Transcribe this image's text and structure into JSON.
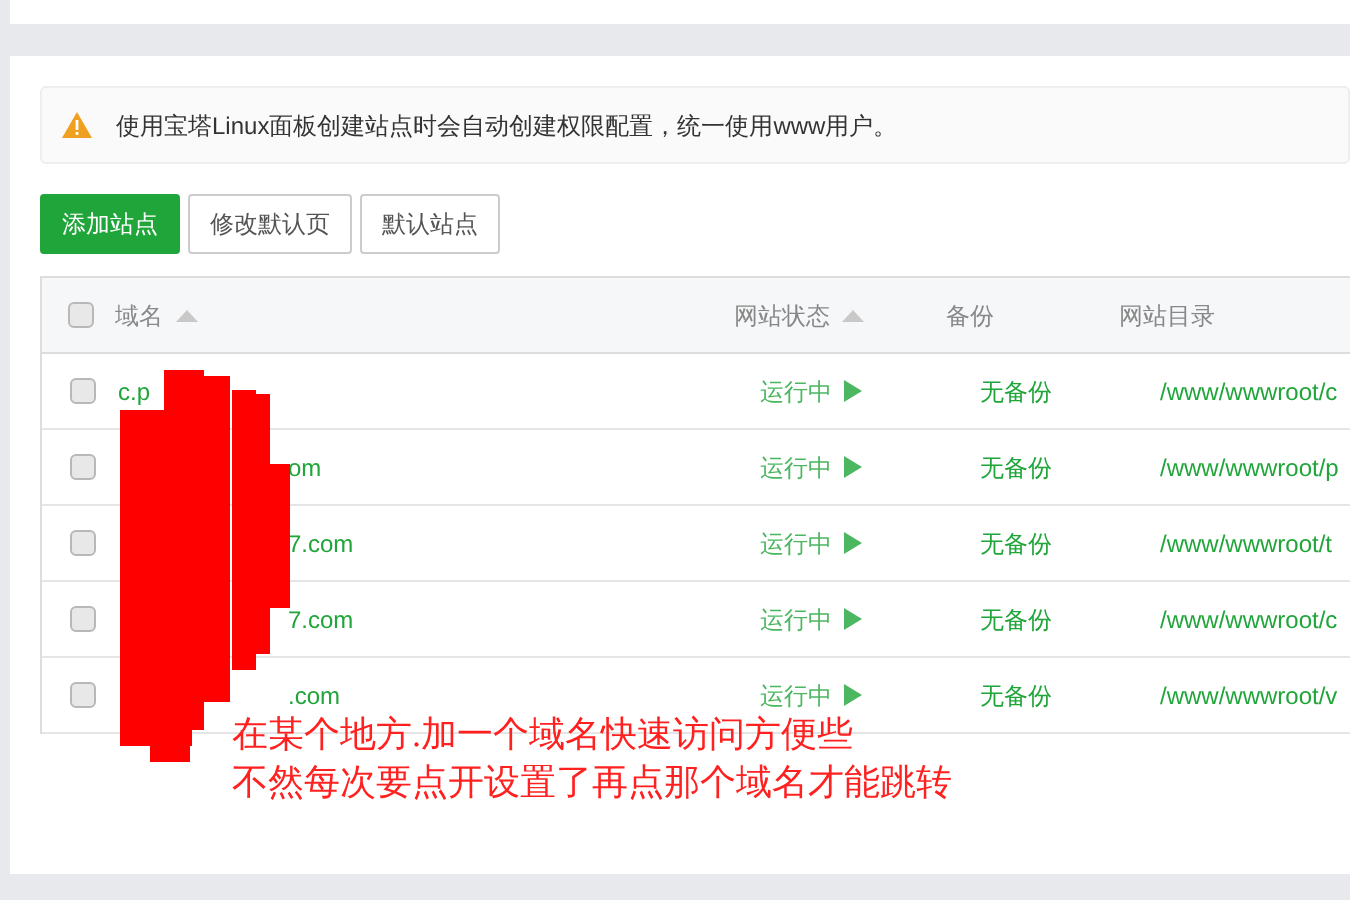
{
  "alert": {
    "text": "使用宝塔Linux面板创建站点时会自动创建权限配置，统一使用www用户。"
  },
  "buttons": [
    {
      "label": "添加站点",
      "kind": "primary"
    },
    {
      "label": "修改默认页",
      "kind": "default"
    },
    {
      "label": "默认站点",
      "kind": "default"
    }
  ],
  "table": {
    "select_all": {
      "checked": false
    },
    "columns": [
      {
        "label": "域名",
        "sortable": true
      },
      {
        "label": "网站状态",
        "sortable": true
      },
      {
        "label": "备份",
        "sortable": false
      },
      {
        "label": "网站目录",
        "sortable": false
      }
    ],
    "rows": [
      {
        "checked": false,
        "domain": "c.p",
        "redacted_prefix": false,
        "status": "运行中",
        "running": true,
        "backup": "无备份",
        "directory": "/www/wwwroot/c"
      },
      {
        "checked": false,
        "domain": "om",
        "redacted_prefix": true,
        "status": "运行中",
        "running": true,
        "backup": "无备份",
        "directory": "/www/wwwroot/p"
      },
      {
        "checked": false,
        "domain": "7.com",
        "redacted_prefix": true,
        "status": "运行中",
        "running": true,
        "backup": "无备份",
        "directory": "/www/wwwroot/t"
      },
      {
        "checked": false,
        "domain": "7.com",
        "redacted_prefix": true,
        "status": "运行中",
        "running": true,
        "backup": "无备份",
        "directory": "/www/wwwroot/c"
      },
      {
        "checked": false,
        "domain": ".com",
        "redacted_prefix": true,
        "status": "运行中",
        "running": true,
        "backup": "无备份",
        "directory": "/www/wwwroot/v"
      }
    ]
  },
  "annotation": {
    "lines": [
      "在某个地方.加一个域名快速访问方便些",
      "不然每次要点开设置了再点那个域名才能跳转"
    ]
  }
}
